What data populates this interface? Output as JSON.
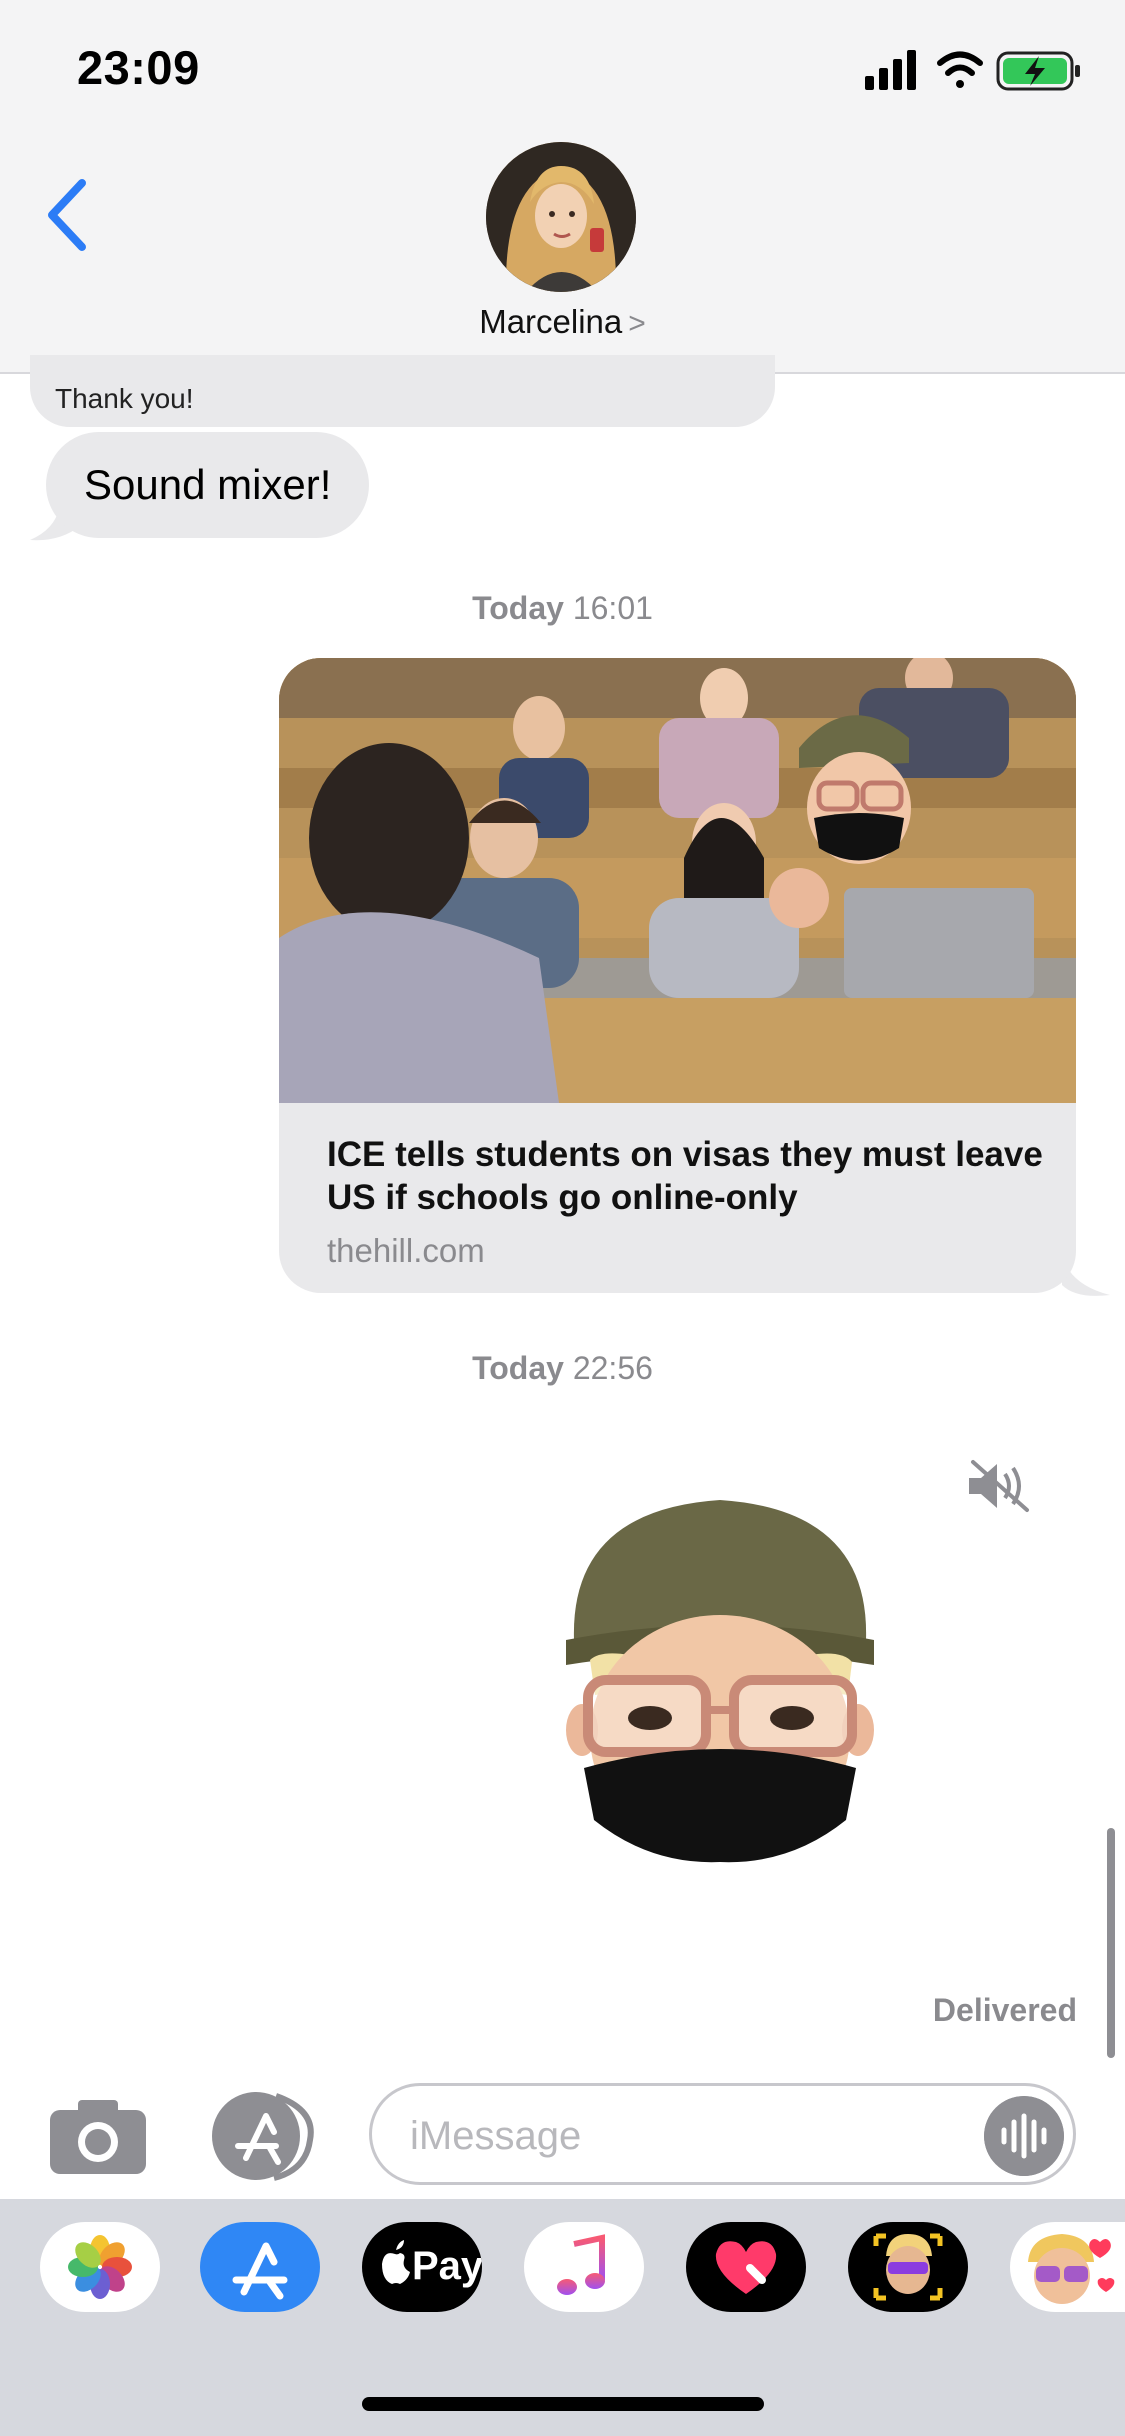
{
  "status_bar": {
    "time": "23:09",
    "icons": [
      "signal-icon",
      "wifi-icon",
      "battery-charging-icon"
    ]
  },
  "header": {
    "contact_name": "Marcelina",
    "chevron": ">"
  },
  "conversation": {
    "previous_caption": "Thank you!",
    "incoming_message": "Sound mixer!",
    "timestamp_1": {
      "day": "Today",
      "time": "16:01"
    },
    "link_preview": {
      "title": "ICE tells students on visas they must leave US if schools go online-only",
      "domain": "thehill.com"
    },
    "timestamp_2": {
      "day": "Today",
      "time": "22:56"
    },
    "memoji_sticker": "memoji-masked-beanie",
    "status": "Delivered"
  },
  "input_bar": {
    "placeholder": "iMessage"
  },
  "app_drawer": {
    "apps": [
      "photos-icon",
      "app-store-icon",
      "apple-pay-icon",
      "music-icon",
      "digital-touch-icon",
      "memoji-camera-icon",
      "memoji-stickers-icon"
    ],
    "apple_pay_label": "Pay"
  },
  "colors": {
    "accent": "#2c7cf6",
    "bubble_gray": "#e9e9eb",
    "secondary_text": "#8a8a8e"
  }
}
